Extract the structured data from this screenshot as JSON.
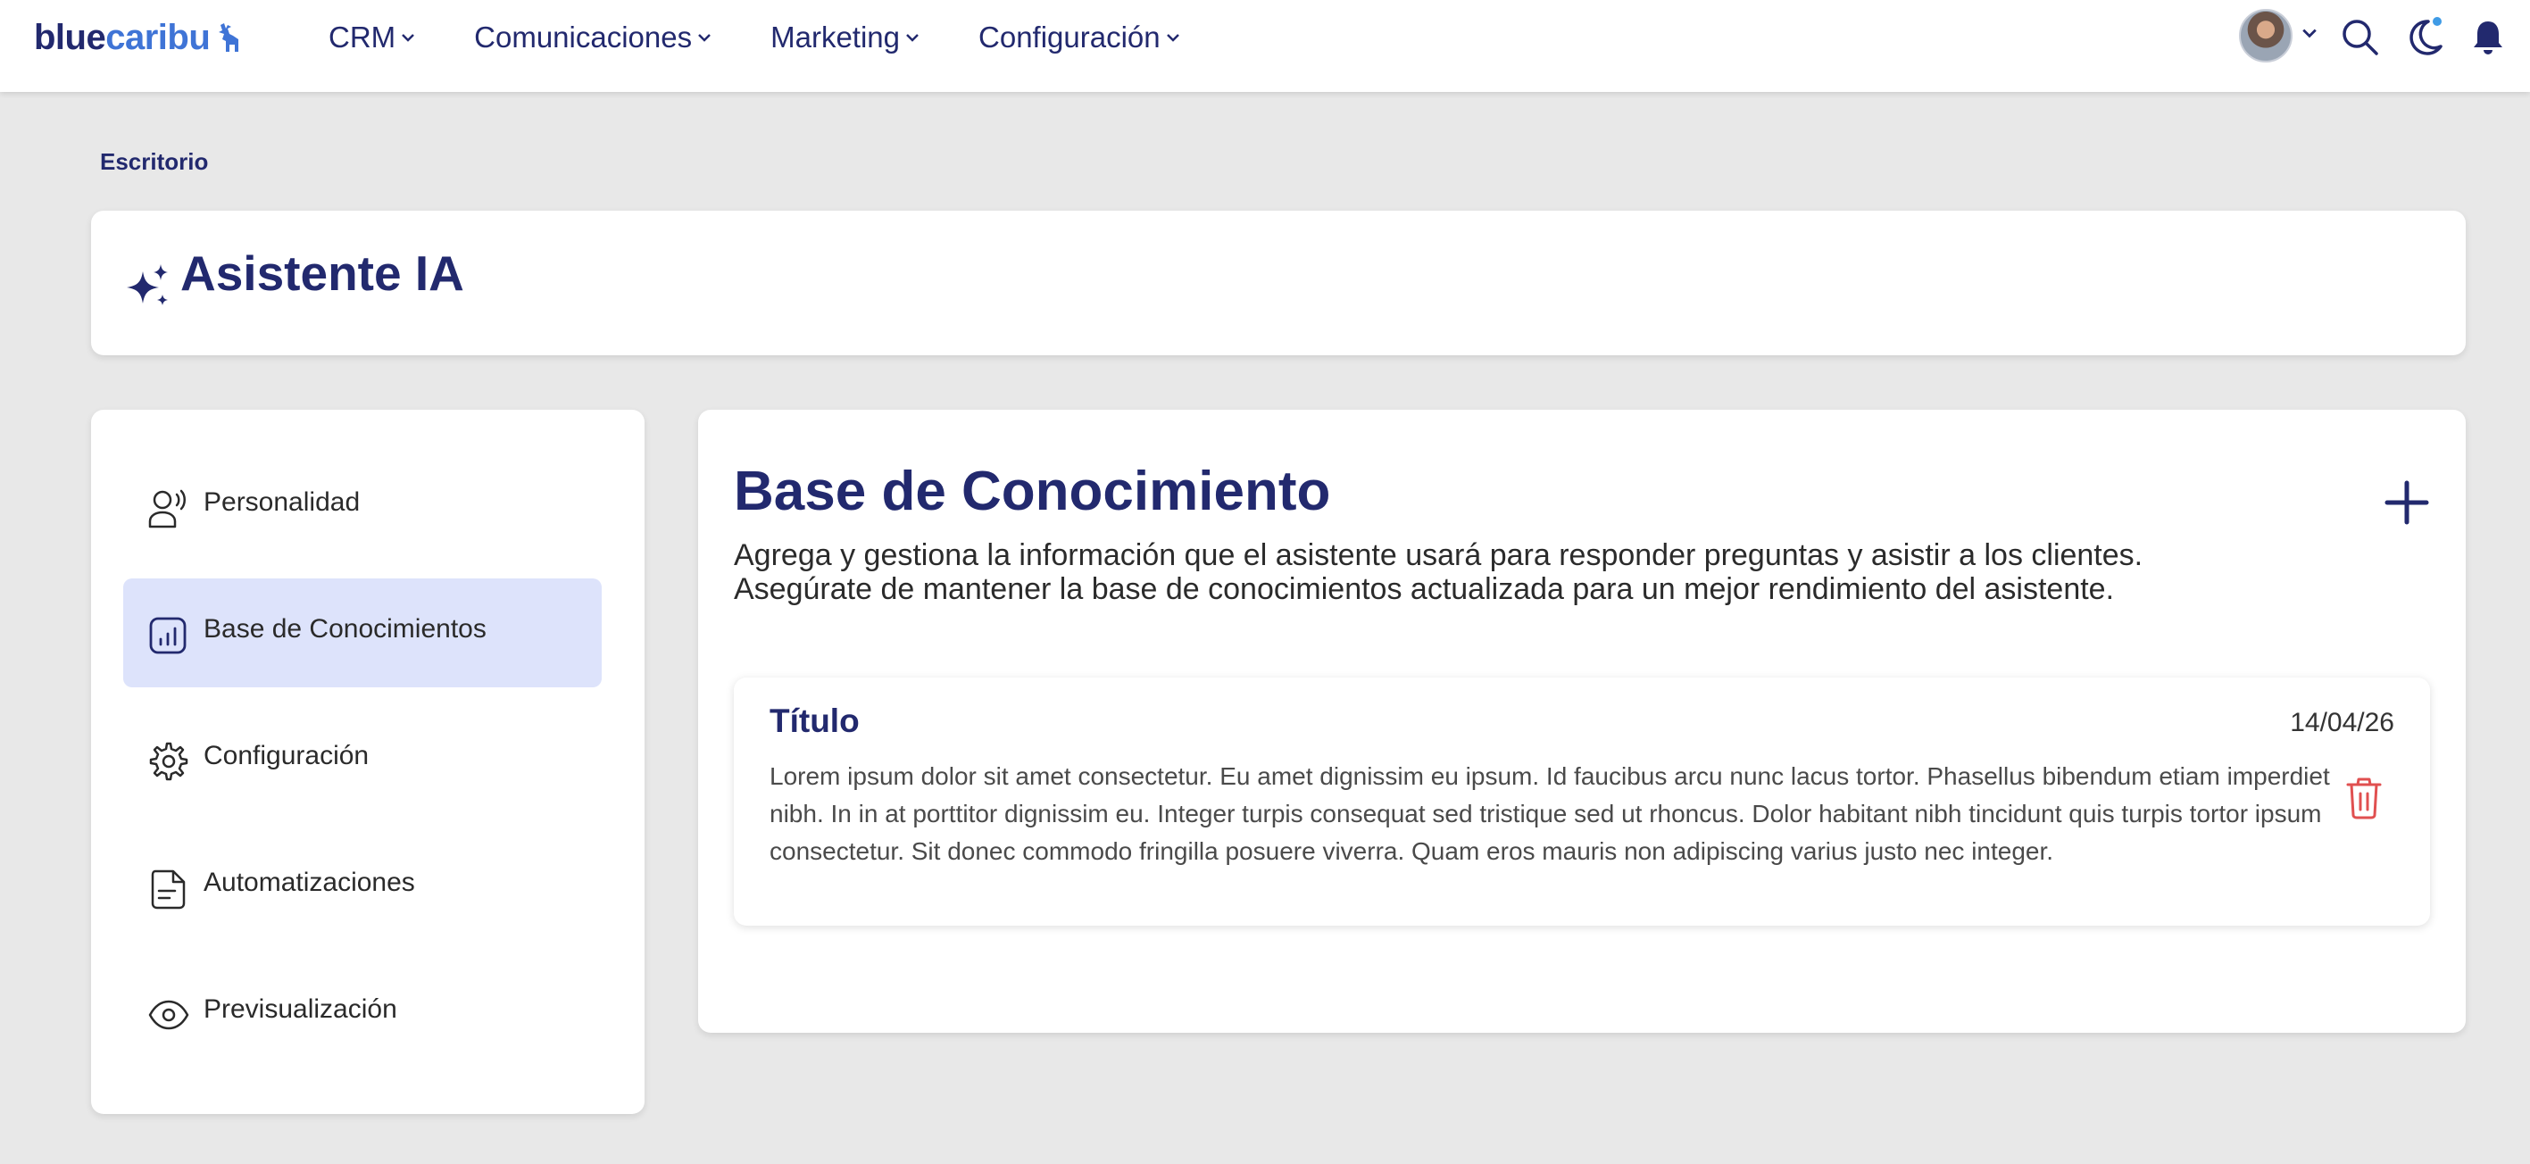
{
  "brand": {
    "part1": "blue",
    "part2": "caribu"
  },
  "nav": [
    {
      "label": "CRM"
    },
    {
      "label": "Comunicaciones"
    },
    {
      "label": "Marketing"
    },
    {
      "label": "Configuración"
    }
  ],
  "breadcrumb": "Escritorio",
  "header": {
    "title": "Asistente IA",
    "icon": "sparkles-icon"
  },
  "sidebar": {
    "items": [
      {
        "label": "Personalidad",
        "icon": "person-voice-icon",
        "active": false
      },
      {
        "label": "Base de Conocimientos",
        "icon": "chart-icon",
        "active": true
      },
      {
        "label": "Configuración",
        "icon": "gear-icon",
        "active": false
      },
      {
        "label": "Automatizaciones",
        "icon": "document-icon",
        "active": false
      },
      {
        "label": "Previsualización",
        "icon": "eye-icon",
        "active": false
      }
    ]
  },
  "main": {
    "title": "Base de Conocimiento",
    "description_line1": "Agrega y gestiona la información que el asistente usará para responder preguntas y asistir a los clientes.",
    "description_line2": "Asegúrate de mantener la base de conocimientos actualizada para un mejor rendimiento del asistente.",
    "entries": [
      {
        "title": "Título",
        "date": "14/04/26",
        "body": "Lorem ipsum dolor sit amet consectetur. Eu amet dignissim eu ipsum. Id faucibus arcu nunc lacus tortor. Phasellus bibendum etiam imperdiet nibh. In in at porttitor dignissim eu. Integer turpis consequat sed tristique sed ut rhoncus. Dolor habitant nibh tincidunt quis turpis tortor ipsum consectetur. Sit donec commodo fringilla posuere viverra. Quam eros mauris non adipiscing varius justo nec integer."
      }
    ]
  },
  "colors": {
    "primary": "#22296e",
    "accent": "#3f74d6",
    "active_bg": "#dde3fb",
    "danger": "#e05050",
    "background": "#e8e8e8"
  }
}
